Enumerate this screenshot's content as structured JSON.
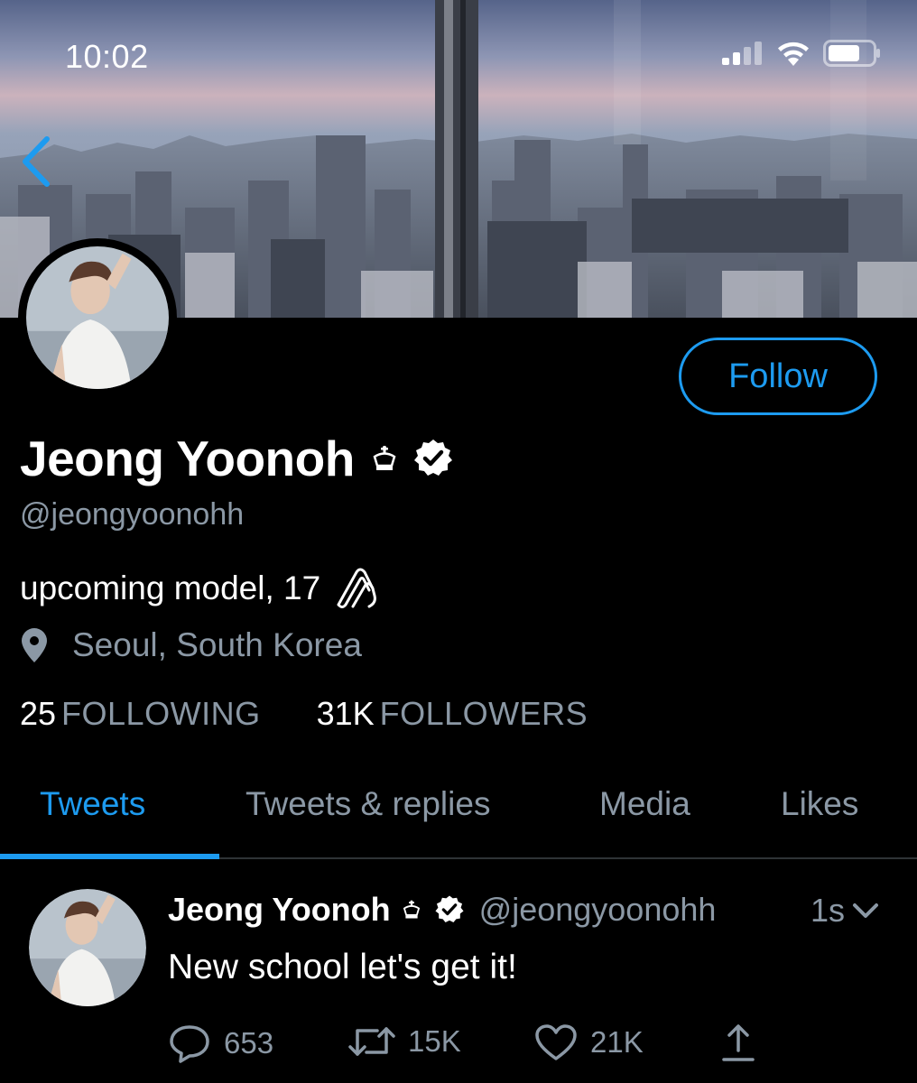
{
  "status_bar": {
    "time": "10:02",
    "icons": [
      "cellular-signal-icon",
      "wifi-icon",
      "battery-icon"
    ]
  },
  "header": {
    "back_icon": "chevron-left-icon"
  },
  "profile": {
    "follow_label": "Follow",
    "display_name": "Jeong Yoonoh",
    "name_badges": [
      "crown-icon",
      "verified-badge-icon"
    ],
    "handle": "@jeongyoonohh",
    "bio": "upcoming model, 17",
    "bio_icon": "paperclip-icon",
    "location": "Seoul, South Korea",
    "location_icon": "location-pin-icon",
    "following_count": "25",
    "following_label": "FOLLOWING",
    "followers_count": "31K",
    "followers_label": "FOLLOWERS"
  },
  "tabs": [
    {
      "label": "Tweets",
      "active": true
    },
    {
      "label": "Tweets & replies",
      "active": false
    },
    {
      "label": "Media",
      "active": false
    },
    {
      "label": "Likes",
      "active": false
    }
  ],
  "tweet": {
    "author_name": "Jeong Yoonoh",
    "author_handle": "@jeongyoonohh",
    "time": "1s",
    "text": "New school let's get it!",
    "replies": "653",
    "retweets": "15K",
    "likes": "21K"
  },
  "colors": {
    "accent": "#1d9bf0",
    "background": "#000000",
    "secondary_text": "#8b98a5",
    "divider": "#2f3336"
  }
}
